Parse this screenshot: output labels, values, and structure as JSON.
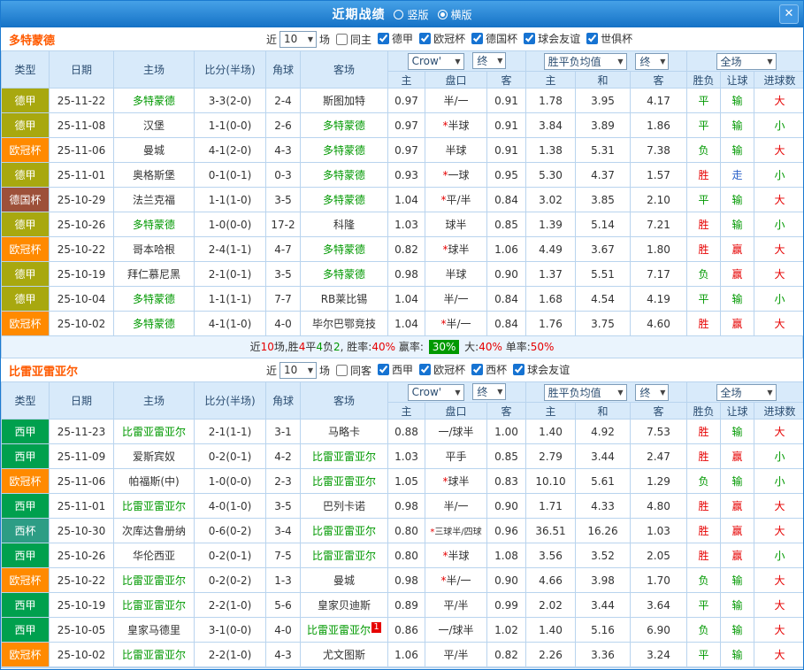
{
  "titlebar": {
    "title": "近期战绩",
    "radios": [
      {
        "label": "竖版",
        "checked": false
      },
      {
        "label": "横版",
        "checked": true
      }
    ],
    "close": "✕"
  },
  "table_header": {
    "type": "类型",
    "date": "日期",
    "home": "主场",
    "score": "比分(半场)",
    "corner": "角球",
    "away": "客场",
    "odds_group": {
      "company": "Crow'",
      "final": "终",
      "sub": [
        "主",
        "盘口",
        "客"
      ]
    },
    "avg_group": {
      "label": "胜平负均值",
      "final": "终",
      "sub": [
        "主",
        "和",
        "客"
      ]
    },
    "result_group": {
      "scope": "全场",
      "sub": [
        "胜负",
        "让球",
        "进球数"
      ]
    }
  },
  "type_colors": {
    "德甲": "#a8a80f",
    "欧冠杯": "#ff8a00",
    "德国杯": "#9d5039",
    "西甲": "#00a04e",
    "西杯": "#2d9d85"
  },
  "result_colors": {
    "r": "#e60000",
    "g": "#009900",
    "b": "#2b62c9"
  },
  "sections": [
    {
      "team": "多特蒙德",
      "filter": {
        "prefix": "近",
        "count": "10",
        "suffix": "场",
        "same_label": "同主",
        "same_checked": false,
        "leagues": [
          "德甲",
          "欧冠杯",
          "德国杯",
          "球会友谊",
          "世俱杯"
        ]
      },
      "rows": [
        {
          "lg": "德甲",
          "date": "25-11-22",
          "home": "多特蒙德",
          "hf": 1,
          "score": "3-3(2-0)",
          "cor": "2-4",
          "away": "斯图加特",
          "af": 0,
          "o1": "0.97",
          "line": "半/一",
          "o2": "0.91",
          "m1": "1.78",
          "m2": "3.95",
          "m3": "4.17",
          "res": [
            "平",
            "g"
          ],
          "let": [
            "输",
            "g"
          ],
          "big": [
            "大",
            "r"
          ]
        },
        {
          "lg": "德甲",
          "date": "25-11-08",
          "home": "汉堡",
          "hf": 0,
          "score": "1-1(0-0)",
          "cor": "2-6",
          "away": "多特蒙德",
          "af": 1,
          "o1": "0.97",
          "line": "*半球",
          "o2": "0.91",
          "m1": "3.84",
          "m2": "3.89",
          "m3": "1.86",
          "res": [
            "平",
            "g"
          ],
          "let": [
            "输",
            "g"
          ],
          "big": [
            "小",
            "g"
          ]
        },
        {
          "lg": "欧冠杯",
          "date": "25-11-06",
          "home": "曼城",
          "hf": 0,
          "score": "4-1(2-0)",
          "cor": "4-3",
          "away": "多特蒙德",
          "af": 1,
          "o1": "0.97",
          "line": "半球",
          "o2": "0.91",
          "m1": "1.38",
          "m2": "5.31",
          "m3": "7.38",
          "res": [
            "负",
            "g"
          ],
          "let": [
            "输",
            "g"
          ],
          "big": [
            "大",
            "r"
          ]
        },
        {
          "lg": "德甲",
          "date": "25-11-01",
          "home": "奥格斯堡",
          "hf": 0,
          "score": "0-1(0-1)",
          "cor": "0-3",
          "away": "多特蒙德",
          "af": 1,
          "o1": "0.93",
          "line": "*一球",
          "o2": "0.95",
          "m1": "5.30",
          "m2": "4.37",
          "m3": "1.57",
          "res": [
            "胜",
            "r"
          ],
          "let": [
            "走",
            "b"
          ],
          "big": [
            "小",
            "g"
          ]
        },
        {
          "lg": "德国杯",
          "date": "25-10-29",
          "home": "法兰克福",
          "hf": 0,
          "score": "1-1(1-0)",
          "cor": "3-5",
          "away": "多特蒙德",
          "af": 1,
          "o1": "1.04",
          "line": "*平/半",
          "o2": "0.84",
          "m1": "3.02",
          "m2": "3.85",
          "m3": "2.10",
          "res": [
            "平",
            "g"
          ],
          "let": [
            "输",
            "g"
          ],
          "big": [
            "大",
            "r"
          ]
        },
        {
          "lg": "德甲",
          "date": "25-10-26",
          "home": "多特蒙德",
          "hf": 1,
          "score": "1-0(0-0)",
          "cor": "17-2",
          "away": "科隆",
          "af": 0,
          "o1": "1.03",
          "line": "球半",
          "o2": "0.85",
          "m1": "1.39",
          "m2": "5.14",
          "m3": "7.21",
          "res": [
            "胜",
            "r"
          ],
          "let": [
            "输",
            "g"
          ],
          "big": [
            "小",
            "g"
          ]
        },
        {
          "lg": "欧冠杯",
          "date": "25-10-22",
          "home": "哥本哈根",
          "hf": 0,
          "score": "2-4(1-1)",
          "cor": "4-7",
          "away": "多特蒙德",
          "af": 1,
          "o1": "0.82",
          "line": "*球半",
          "o2": "1.06",
          "m1": "4.49",
          "m2": "3.67",
          "m3": "1.80",
          "res": [
            "胜",
            "r"
          ],
          "let": [
            "赢",
            "r"
          ],
          "big": [
            "大",
            "r"
          ]
        },
        {
          "lg": "德甲",
          "date": "25-10-19",
          "home": "拜仁慕尼黑",
          "hf": 0,
          "score": "2-1(0-1)",
          "cor": "3-5",
          "away": "多特蒙德",
          "af": 1,
          "o1": "0.98",
          "line": "半球",
          "o2": "0.90",
          "m1": "1.37",
          "m2": "5.51",
          "m3": "7.17",
          "res": [
            "负",
            "g"
          ],
          "let": [
            "赢",
            "r"
          ],
          "big": [
            "大",
            "r"
          ]
        },
        {
          "lg": "德甲",
          "date": "25-10-04",
          "home": "多特蒙德",
          "hf": 1,
          "score": "1-1(1-1)",
          "cor": "7-7",
          "away": "RB莱比锡",
          "af": 0,
          "o1": "1.04",
          "line": "半/一",
          "o2": "0.84",
          "m1": "1.68",
          "m2": "4.54",
          "m3": "4.19",
          "res": [
            "平",
            "g"
          ],
          "let": [
            "输",
            "g"
          ],
          "big": [
            "小",
            "g"
          ]
        },
        {
          "lg": "欧冠杯",
          "date": "25-10-02",
          "home": "多特蒙德",
          "hf": 1,
          "score": "4-1(1-0)",
          "cor": "4-0",
          "away": "毕尔巴鄂竞技",
          "af": 0,
          "o1": "1.04",
          "line": "*半/一",
          "o2": "0.84",
          "m1": "1.76",
          "m2": "3.75",
          "m3": "4.60",
          "res": [
            "胜",
            "r"
          ],
          "let": [
            "赢",
            "r"
          ],
          "big": [
            "大",
            "r"
          ]
        }
      ],
      "summary": [
        [
          "近",
          ""
        ],
        [
          "10",
          "r"
        ],
        [
          "场,胜",
          ""
        ],
        [
          "4",
          "r"
        ],
        [
          "平",
          ""
        ],
        [
          "4",
          "g"
        ],
        [
          "负",
          ""
        ],
        [
          "2",
          "g"
        ],
        [
          ", 胜率:",
          ""
        ],
        [
          "40%",
          "r"
        ],
        [
          " 赢率: ",
          ""
        ],
        [
          "30%",
          "badge"
        ],
        [
          " 大:",
          ""
        ],
        [
          "40%",
          "r"
        ],
        [
          " 单率:",
          ""
        ],
        [
          "50%",
          "r"
        ]
      ]
    },
    {
      "team": "比雷亚雷亚尔",
      "filter": {
        "prefix": "近",
        "count": "10",
        "suffix": "场",
        "same_label": "同客",
        "same_checked": false,
        "leagues": [
          "西甲",
          "欧冠杯",
          "西杯",
          "球会友谊"
        ]
      },
      "rows": [
        {
          "lg": "西甲",
          "date": "25-11-23",
          "home": "比雷亚雷亚尔",
          "hf": 1,
          "score": "2-1(1-1)",
          "cor": "3-1",
          "away": "马略卡",
          "af": 0,
          "o1": "0.88",
          "line": "一/球半",
          "o2": "1.00",
          "m1": "1.40",
          "m2": "4.92",
          "m3": "7.53",
          "res": [
            "胜",
            "r"
          ],
          "let": [
            "输",
            "g"
          ],
          "big": [
            "大",
            "r"
          ]
        },
        {
          "lg": "西甲",
          "date": "25-11-09",
          "home": "爱斯宾奴",
          "hf": 0,
          "score": "0-2(0-1)",
          "cor": "4-2",
          "away": "比雷亚雷亚尔",
          "af": 1,
          "o1": "1.03",
          "line": "平手",
          "o2": "0.85",
          "m1": "2.79",
          "m2": "3.44",
          "m3": "2.47",
          "res": [
            "胜",
            "r"
          ],
          "let": [
            "赢",
            "r"
          ],
          "big": [
            "小",
            "g"
          ]
        },
        {
          "lg": "欧冠杯",
          "date": "25-11-06",
          "home": "帕福斯(中)",
          "hf": 0,
          "score": "1-0(0-0)",
          "cor": "2-3",
          "away": "比雷亚雷亚尔",
          "af": 1,
          "o1": "1.05",
          "line": "*球半",
          "o2": "0.83",
          "m1": "10.10",
          "m2": "5.61",
          "m3": "1.29",
          "res": [
            "负",
            "g"
          ],
          "let": [
            "输",
            "g"
          ],
          "big": [
            "小",
            "g"
          ]
        },
        {
          "lg": "西甲",
          "date": "25-11-01",
          "home": "比雷亚雷亚尔",
          "hf": 1,
          "score": "4-0(1-0)",
          "cor": "3-5",
          "away": "巴列卡诺",
          "af": 0,
          "o1": "0.98",
          "line": "半/一",
          "o2": "0.90",
          "m1": "1.71",
          "m2": "4.33",
          "m3": "4.80",
          "res": [
            "胜",
            "r"
          ],
          "let": [
            "赢",
            "r"
          ],
          "big": [
            "大",
            "r"
          ]
        },
        {
          "lg": "西杯",
          "date": "25-10-30",
          "home": "次库达鲁册纳",
          "hf": 0,
          "score": "0-6(0-2)",
          "cor": "3-4",
          "away": "比雷亚雷亚尔",
          "af": 1,
          "o1": "0.80",
          "line": "*三球半/四球",
          "o2": "0.96",
          "m1": "36.51",
          "m2": "16.26",
          "m3": "1.03",
          "res": [
            "胜",
            "r"
          ],
          "let": [
            "赢",
            "r"
          ],
          "big": [
            "大",
            "r"
          ]
        },
        {
          "lg": "西甲",
          "date": "25-10-26",
          "home": "华伦西亚",
          "hf": 0,
          "score": "0-2(0-1)",
          "cor": "7-5",
          "away": "比雷亚雷亚尔",
          "af": 1,
          "o1": "0.80",
          "line": "*半球",
          "o2": "1.08",
          "m1": "3.56",
          "m2": "3.52",
          "m3": "2.05",
          "res": [
            "胜",
            "r"
          ],
          "let": [
            "赢",
            "r"
          ],
          "big": [
            "小",
            "g"
          ]
        },
        {
          "lg": "欧冠杯",
          "date": "25-10-22",
          "home": "比雷亚雷亚尔",
          "hf": 1,
          "score": "0-2(0-2)",
          "cor": "1-3",
          "away": "曼城",
          "af": 0,
          "o1": "0.98",
          "line": "*半/一",
          "o2": "0.90",
          "m1": "4.66",
          "m2": "3.98",
          "m3": "1.70",
          "res": [
            "负",
            "g"
          ],
          "let": [
            "输",
            "g"
          ],
          "big": [
            "大",
            "r"
          ]
        },
        {
          "lg": "西甲",
          "date": "25-10-19",
          "home": "比雷亚雷亚尔",
          "hf": 1,
          "score": "2-2(1-0)",
          "cor": "5-6",
          "away": "皇家贝迪斯",
          "af": 0,
          "o1": "0.89",
          "line": "平/半",
          "o2": "0.99",
          "m1": "2.02",
          "m2": "3.44",
          "m3": "3.64",
          "res": [
            "平",
            "g"
          ],
          "let": [
            "输",
            "g"
          ],
          "big": [
            "大",
            "r"
          ]
        },
        {
          "lg": "西甲",
          "date": "25-10-05",
          "home": "皇家马德里",
          "hf": 0,
          "score": "3-1(0-0)",
          "cor": "4-0",
          "away": "比雷亚雷亚尔",
          "af": 1,
          "acard": "1",
          "o1": "0.86",
          "line": "一/球半",
          "o2": "1.02",
          "m1": "1.40",
          "m2": "5.16",
          "m3": "6.90",
          "res": [
            "负",
            "g"
          ],
          "let": [
            "输",
            "g"
          ],
          "big": [
            "大",
            "r"
          ]
        },
        {
          "lg": "欧冠杯",
          "date": "25-10-02",
          "home": "比雷亚雷亚尔",
          "hf": 1,
          "score": "2-2(1-0)",
          "cor": "4-3",
          "away": "尤文图斯",
          "af": 0,
          "o1": "1.06",
          "line": "平/半",
          "o2": "0.82",
          "m1": "2.26",
          "m2": "3.36",
          "m3": "3.24",
          "res": [
            "平",
            "g"
          ],
          "let": [
            "输",
            "g"
          ],
          "big": [
            "大",
            "r"
          ]
        }
      ]
    }
  ]
}
